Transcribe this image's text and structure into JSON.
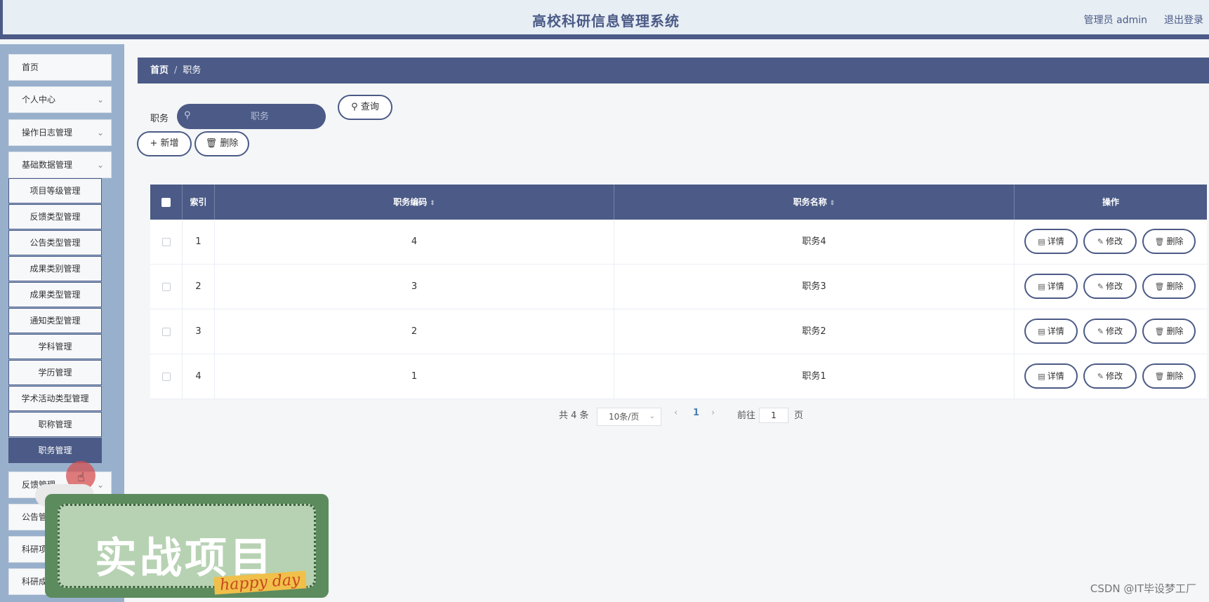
{
  "header": {
    "title": "高校科研信息管理系统",
    "user": "管理员 admin",
    "logout": "退出登录"
  },
  "sidebar": {
    "items": [
      {
        "label": "首页",
        "has_chevron": false
      },
      {
        "label": "个人中心",
        "has_chevron": true
      },
      {
        "label": "操作日志管理",
        "has_chevron": true
      },
      {
        "label": "基础数据管理",
        "has_chevron": true
      }
    ],
    "sub_items": [
      {
        "label": "项目等级管理",
        "active": false
      },
      {
        "label": "反馈类型管理",
        "active": false
      },
      {
        "label": "公告类型管理",
        "active": false
      },
      {
        "label": "成果类别管理",
        "active": false
      },
      {
        "label": "成果类型管理",
        "active": false
      },
      {
        "label": "通知类型管理",
        "active": false
      },
      {
        "label": "学科管理",
        "active": false
      },
      {
        "label": "学历管理",
        "active": false
      },
      {
        "label": "学术活动类型管理",
        "active": false
      },
      {
        "label": "职称管理",
        "active": false
      },
      {
        "label": "职务管理",
        "active": true
      }
    ],
    "lower_items": [
      {
        "label": "反馈管理",
        "has_chevron": true
      },
      {
        "label": "公告管理",
        "has_chevron": false
      },
      {
        "label": "科研项目管理",
        "has_chevron": false
      },
      {
        "label": "科研成果管理",
        "has_chevron": false
      }
    ]
  },
  "breadcrumb": {
    "home": "首页",
    "separator": "/",
    "current": "职务"
  },
  "search": {
    "label": "职务",
    "placeholder": "职务",
    "query_button": "查询"
  },
  "toolbar": {
    "add_label": "新增",
    "delete_label": "删除"
  },
  "table": {
    "columns": [
      "索引",
      "职务编码",
      "职务名称",
      "操作"
    ],
    "rows": [
      {
        "index": "1",
        "code": "4",
        "name": "职务4"
      },
      {
        "index": "2",
        "code": "3",
        "name": "职务3"
      },
      {
        "index": "3",
        "code": "2",
        "name": "职务2"
      },
      {
        "index": "4",
        "code": "1",
        "name": "职务1"
      }
    ],
    "actions": {
      "detail": "详情",
      "edit": "修改",
      "delete": "删除"
    }
  },
  "pagination": {
    "total": "共 4 条",
    "page_size": "10条/页",
    "current_page": "1",
    "goto_label": "前往",
    "goto_value": "1",
    "page_suffix": "页"
  },
  "overlay": {
    "banner_text": "实战项目",
    "banner_sub": "happy day",
    "watermark": "CSDN @IT毕设梦工厂"
  },
  "colors": {
    "primary": "#4b5a86",
    "sidebar_bg": "#98b0cc",
    "header_bg": "#e7eef4"
  }
}
